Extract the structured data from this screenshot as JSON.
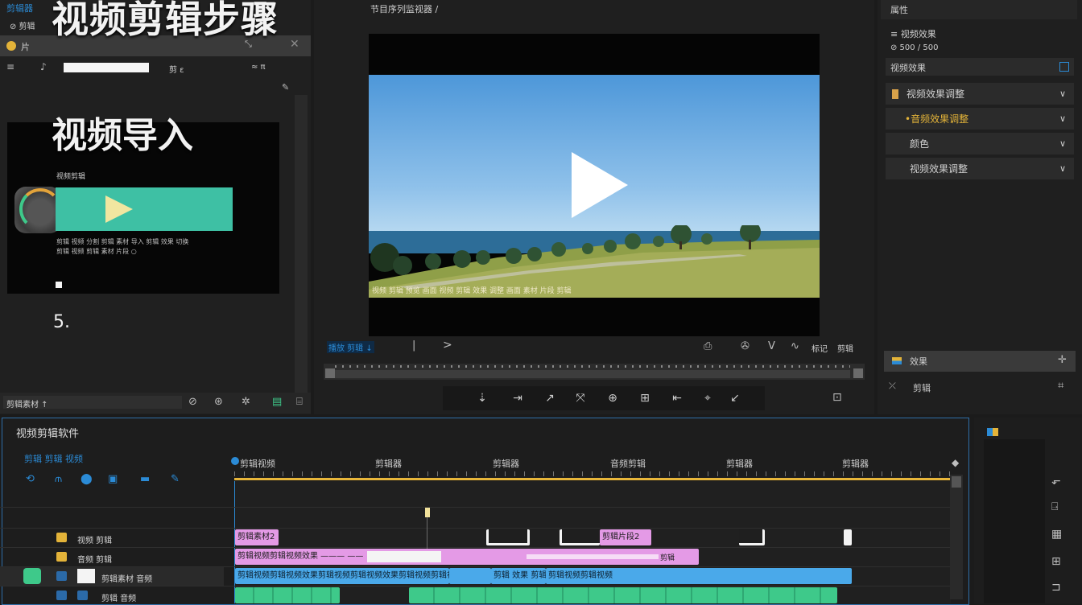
{
  "overlay": {
    "title": "视频剪辑步骤",
    "subtitle": "视频导入",
    "step_number": "5."
  },
  "project_panel": {
    "tab_label": "剪辑器",
    "tab_sub": "⊘ 剪辑",
    "header_label": "片",
    "row1_icons": [
      "≡",
      "♪"
    ],
    "row1_mid": "剪 ε",
    "row1_right": "≈ π",
    "thumb_caption": "视频剪辑",
    "thumb_line1": "剪辑 视频 分割 剪辑 素材 导入 剪辑 效果 切换",
    "thumb_line2": "剪辑 视频 剪辑 素材 片段 ○",
    "bottom_label": "剪辑素材 ↑"
  },
  "monitor": {
    "header_label": "节目序列监视器 ∕",
    "video_caption": "视频 剪辑 预览 画面 视频 剪辑 效果 调整 画面 素材 片段 剪辑",
    "transport_left": "播放 剪辑 ↓",
    "transport_right": [
      "标记",
      "剪辑"
    ],
    "tool_icons": [
      "⇣",
      "⇥",
      "↗",
      "⤧",
      "⊕",
      "⊞",
      "⇤",
      "⌖",
      "↙"
    ]
  },
  "properties": {
    "header": "属性",
    "row1": "≡ 视频效果",
    "row2": "⊘ 500 / 500",
    "section_label": "视频效果",
    "accordions": [
      "视频效果调整",
      "•音频效果调整",
      "颜色",
      "视频效果调整"
    ],
    "effect_label": "效果",
    "effect2_label": "剪辑"
  },
  "timeline": {
    "title": "视频剪辑软件",
    "toolbar_label": "剪辑 剪辑 视频",
    "ruler_labels": [
      "剪辑视频",
      "剪辑器",
      "剪辑器",
      "音频剪辑",
      "剪辑器",
      "剪辑器"
    ],
    "tracks": [
      {
        "name": "视频 剪辑"
      },
      {
        "name": "音频 剪辑"
      },
      {
        "name": "剪辑素材 音频"
      },
      {
        "name": "剪辑 音频"
      }
    ],
    "clips_pink": [
      "剪辑素材2",
      "剪辑片段2",
      "剪辑视频剪辑视频效果 ——— ——",
      "剪辑"
    ],
    "clip_blue_1": "剪辑视频剪辑视频效果剪辑视频剪辑视频效果剪辑视频剪辑视频 ⊘",
    "clip_blue_2": "剪辑 效果 剪辑",
    "clip_blue_3": "剪辑视频剪辑视频"
  },
  "colors": {
    "accent": "#2b8bd6",
    "pink_clip": "#e49ae6",
    "blue_clip": "#4aa9ea",
    "green_clip": "#3ec98a",
    "ruler_line": "#e8b63a"
  }
}
